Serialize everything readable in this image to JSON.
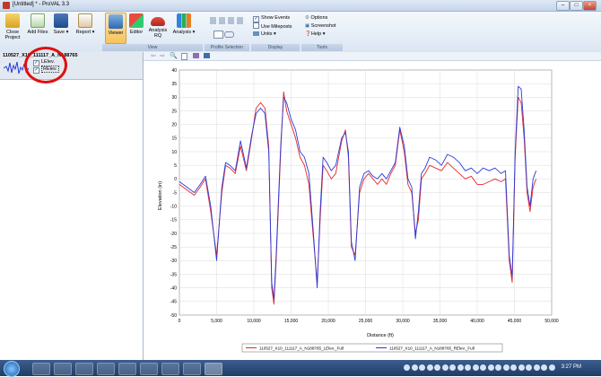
{
  "window": {
    "title": "[Untitled] * - ProVAL 3.3"
  },
  "ribbon": {
    "buttons": {
      "close_project": "Close\nProject",
      "add_files": "Add Files",
      "save": "Save",
      "report": "Report",
      "viewer": "Viewer",
      "editor": "Editor",
      "analysis_rq": "Analysis\nRQ",
      "analysis": "Analysis"
    },
    "groups": {
      "view": "View",
      "profile_selection": "Profile Selection",
      "display": "Display",
      "tools": "Tools"
    },
    "display": {
      "show_events": "Show Events",
      "use_mileposts": "Use Mileposts",
      "units": "Units"
    },
    "tools": {
      "options": "Options",
      "screenshot": "Screenshot",
      "help": "Help"
    }
  },
  "tree": {
    "file_name": "110527_X10_111117_A_N188765",
    "channels": [
      "LElev.",
      "RElev."
    ]
  },
  "chart_data": {
    "type": "line",
    "xlabel": "Distance (ft)",
    "ylabel": "Elevation (in)",
    "xlim": [
      0,
      50000
    ],
    "ylim": [
      -50,
      40
    ],
    "x_ticks": [
      "0",
      "5,000",
      "10,000",
      "15,000",
      "20,000",
      "25,000",
      "30,000",
      "35,000",
      "40,000",
      "45,000",
      "50,000"
    ],
    "y_ticks": [
      "40",
      "35",
      "30",
      "25",
      "20",
      "15",
      "10",
      "5",
      "0",
      "-5",
      "-10",
      "-15",
      "-20",
      "-25",
      "-30",
      "-35",
      "-40",
      "-45",
      "-50"
    ],
    "grid": true,
    "legend_position": "bottom-center",
    "series": [
      {
        "name": "110527_X10_111117_A_N188765_LElev._Full",
        "color": "#e8262a",
        "x": [
          0,
          1000,
          2000,
          2800,
          3500,
          4200,
          5000,
          5700,
          6200,
          6800,
          7500,
          8200,
          9000,
          9700,
          10300,
          10900,
          11500,
          12000,
          12400,
          12700,
          13000,
          13600,
          14000,
          14400,
          15000,
          15600,
          16200,
          16800,
          17400,
          18000,
          18500,
          18900,
          19300,
          19800,
          20400,
          21000,
          21800,
          22300,
          22700,
          23100,
          23600,
          24200,
          24800,
          25400,
          26000,
          26600,
          27200,
          27800,
          28400,
          29000,
          29600,
          30200,
          30700,
          31200,
          31700,
          32100,
          32500,
          33000,
          33600,
          34400,
          35200,
          36000,
          36800,
          37600,
          38400,
          39200,
          40000,
          40800,
          41600,
          42400,
          43200,
          43800,
          44300,
          44700,
          45100,
          45500,
          45900,
          46300,
          46700,
          47100,
          47500,
          47900
        ],
        "y": [
          -2,
          -4,
          -6,
          -3,
          0,
          -12,
          -28,
          -5,
          5,
          4,
          2,
          12,
          3,
          15,
          26,
          28,
          26,
          12,
          -40,
          -46,
          -30,
          10,
          32,
          25,
          20,
          15,
          8,
          5,
          -2,
          -22,
          -38,
          -15,
          5,
          3,
          0,
          2,
          14,
          18,
          8,
          -25,
          -28,
          -5,
          0,
          2,
          0,
          -2,
          0,
          -2,
          2,
          5,
          18,
          10,
          -2,
          -5,
          -20,
          -15,
          0,
          2,
          5,
          4,
          3,
          6,
          4,
          2,
          0,
          1,
          -2,
          -2,
          -1,
          0,
          -1,
          0,
          -30,
          -38,
          8,
          30,
          28,
          15,
          -5,
          -12,
          -3,
          0
        ]
      },
      {
        "name": "110527_X10_111117_A_N188765_RElev._Full",
        "color": "#2b3bd8",
        "x": [
          0,
          1000,
          2000,
          2800,
          3500,
          4200,
          5000,
          5700,
          6200,
          6800,
          7500,
          8200,
          9000,
          9700,
          10300,
          10900,
          11500,
          12000,
          12400,
          12700,
          13000,
          13600,
          14000,
          14400,
          15000,
          15600,
          16200,
          16800,
          17400,
          18000,
          18500,
          18900,
          19300,
          19800,
          20400,
          21000,
          21800,
          22300,
          22700,
          23100,
          23600,
          24200,
          24800,
          25400,
          26000,
          26600,
          27200,
          27800,
          28400,
          29000,
          29600,
          30200,
          30700,
          31200,
          31700,
          32100,
          32500,
          33000,
          33600,
          34400,
          35200,
          36000,
          36800,
          37600,
          38400,
          39200,
          40000,
          40800,
          41600,
          42400,
          43200,
          43800,
          44300,
          44700,
          45100,
          45500,
          45900,
          46300,
          46700,
          47100,
          47500,
          47900
        ],
        "y": [
          -1,
          -3,
          -5,
          -2,
          1,
          -10,
          -30,
          -3,
          6,
          5,
          3,
          14,
          4,
          16,
          24,
          26,
          24,
          10,
          -38,
          -44,
          -28,
          12,
          30,
          28,
          22,
          18,
          10,
          8,
          2,
          -20,
          -40,
          -12,
          8,
          6,
          3,
          5,
          15,
          17,
          10,
          -23,
          -30,
          -3,
          2,
          3,
          1,
          0,
          2,
          0,
          3,
          6,
          19,
          12,
          0,
          -3,
          -22,
          -12,
          2,
          4,
          8,
          7,
          5,
          9,
          8,
          6,
          3,
          4,
          2,
          4,
          3,
          4,
          2,
          3,
          -28,
          -36,
          10,
          34,
          33,
          18,
          -3,
          -10,
          0,
          3
        ]
      }
    ]
  }
}
